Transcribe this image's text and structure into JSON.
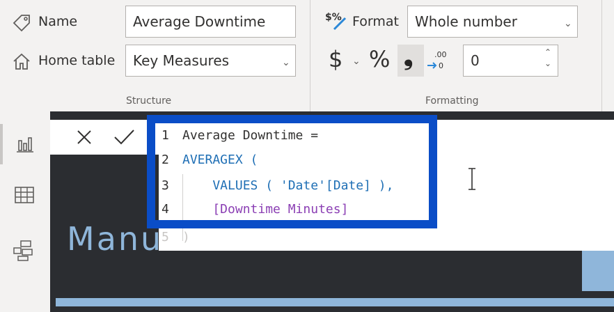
{
  "ribbon": {
    "structure": {
      "name_label": "Name",
      "name_value": "Average Downtime",
      "home_table_label": "Home table",
      "home_table_value": "Key Measures",
      "group_label": "Structure"
    },
    "formatting": {
      "format_label": "Format",
      "format_value": "Whole number",
      "currency_symbol": "$",
      "percent_symbol": "%",
      "comma_symbol": "❟",
      "decimal_places_value": "0",
      "group_label": "Formatting"
    }
  },
  "formula_bar": {
    "lines": [
      {
        "num": "1",
        "text": "Average Downtime ="
      },
      {
        "num": "2",
        "text": "AVERAGEX ("
      },
      {
        "num": "3",
        "text": "    VALUES ( 'Date'[Date] ),"
      },
      {
        "num": "4",
        "text": "    [Downtime Minutes]"
      },
      {
        "num": "5",
        "text": ")"
      }
    ]
  },
  "canvas": {
    "background_text": "Manu"
  },
  "colors": {
    "highlight": "#0a4dc7",
    "keyword": "#1f6fb5",
    "measure": "#8b3fb4"
  }
}
